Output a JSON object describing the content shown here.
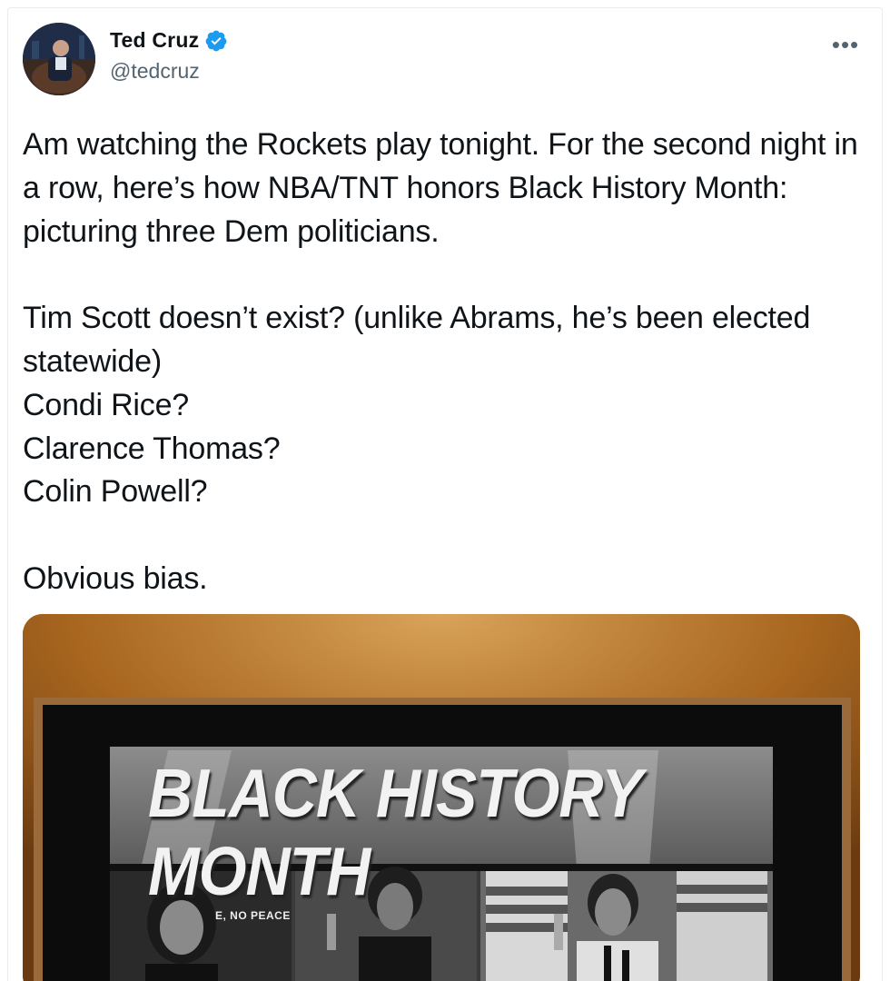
{
  "tweet": {
    "author": {
      "display_name": "Ted Cruz",
      "handle": "@tedcruz",
      "verified": true
    },
    "text": "Am watching the Rockets play tonight. For the second night in a row, here’s how NBA/TNT honors Black History Month: picturing three Dem politicians.\n\nTim Scott doesn’t exist? (unlike Abrams, he’s been elected statewide)\nCondi Rice?\nClarence Thomas?\nColin Powell?\n\nObvious bias.",
    "more_icon": "more-horizontal-icon",
    "media": {
      "headline": "BLACK HISTORY MONTH",
      "sign_text": "E, NO PEACE"
    }
  },
  "colors": {
    "text": "#0f1419",
    "secondary": "#536471",
    "verified": "#1d9bf0",
    "border": "#e6ecf0"
  }
}
